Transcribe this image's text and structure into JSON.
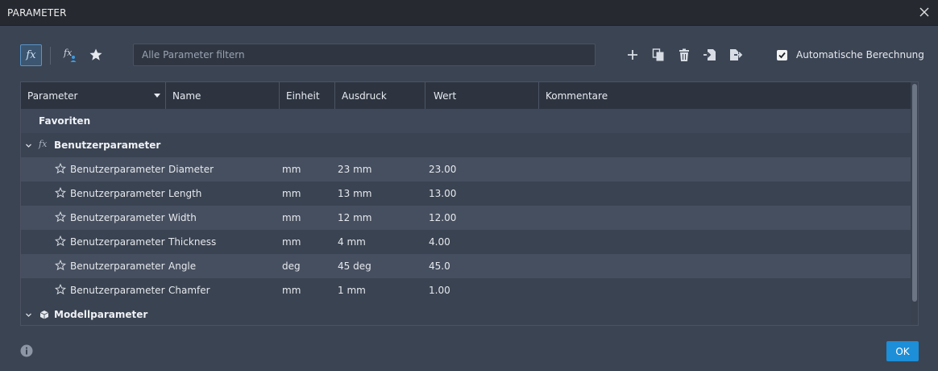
{
  "window": {
    "title": "PARAMETER"
  },
  "toolbar": {
    "fx_label": "fx",
    "search_placeholder": "Alle Parameter filtern",
    "actions": [
      "add-icon",
      "copy-icon",
      "delete-icon",
      "import-icon",
      "export-icon"
    ],
    "auto_calc_label": "Automatische Berechnung",
    "auto_calc_checked": true
  },
  "table": {
    "headers": [
      "Parameter",
      "Name",
      "Einheit",
      "Ausdruck",
      "Wert",
      "Kommentare"
    ],
    "favorites_label": "Favoriten",
    "user_group_label": "Benutzerparameter",
    "model_group_label": "Modellparameter",
    "rows": [
      {
        "parameter": "Benutzerparameter",
        "name": "Diameter",
        "unit": "mm",
        "expression": "23 mm",
        "value": "23.00"
      },
      {
        "parameter": "Benutzerparameter",
        "name": "Length",
        "unit": "mm",
        "expression": "13 mm",
        "value": "13.00"
      },
      {
        "parameter": "Benutzerparameter",
        "name": "Width",
        "unit": "mm",
        "expression": "12 mm",
        "value": "12.00"
      },
      {
        "parameter": "Benutzerparameter",
        "name": "Thickness",
        "unit": "mm",
        "expression": "4 mm",
        "value": "4.00"
      },
      {
        "parameter": "Benutzerparameter",
        "name": "Angle",
        "unit": "deg",
        "expression": "45 deg",
        "value": "45.0"
      },
      {
        "parameter": "Benutzerparameter",
        "name": "Chamfer",
        "unit": "mm",
        "expression": "1 mm",
        "value": "1.00"
      }
    ]
  },
  "footer": {
    "ok_label": "OK"
  },
  "colors": {
    "accent": "#1d8ed8",
    "background": "#3b4453",
    "titlebar": "#262a30"
  }
}
